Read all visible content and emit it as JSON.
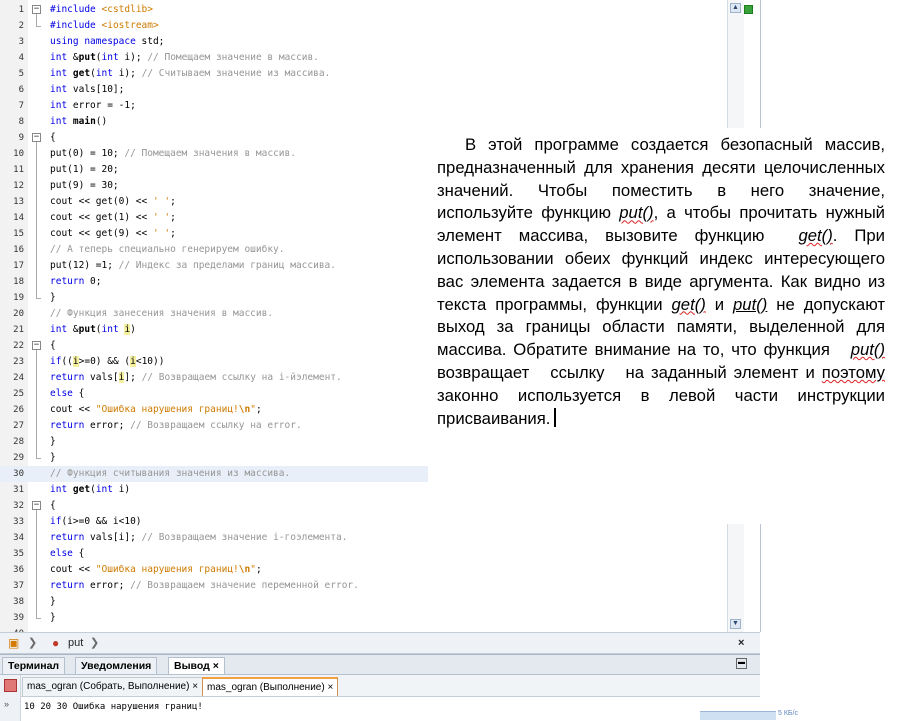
{
  "code_lines": [
    {
      "n": "1",
      "fold": "minus",
      "html": "<span class=\"kw\">#include</span> <span class=\"st\">&lt;cstdlib&gt;</span>"
    },
    {
      "n": "2",
      "fold": "end",
      "html": "<span class=\"kw\">#include</span> <span class=\"st\">&lt;iostream&gt;</span>"
    },
    {
      "n": "3",
      "html": "<span class=\"kw\">using namespace</span> std;"
    },
    {
      "n": "4",
      "html": "<span class=\"kw\">int</span> &amp;<span class=\"b\">put</span>(<span class=\"kw\">int</span> i); <span class=\"cm\">// Помещаем значение в массив.</span>"
    },
    {
      "n": "5",
      "html": "<span class=\"kw\">int</span> <span class=\"b\">get</span>(<span class=\"kw\">int</span> i); <span class=\"cm\">// Считываем значение из массива.</span>"
    },
    {
      "n": "6",
      "html": "<span class=\"kw\">int</span> vals[10];"
    },
    {
      "n": "7",
      "html": "<span class=\"kw\">int</span> error = -1;"
    },
    {
      "n": "8",
      "html": "<span class=\"kw\">int</span> <span class=\"b\">main</span>()"
    },
    {
      "n": "9",
      "fold": "minus",
      "html": "{"
    },
    {
      "n": "10",
      "html": "put(0) = 10; <span class=\"cm\">// Помещаем значения в массив.</span>"
    },
    {
      "n": "11",
      "html": "put(1) = 20;"
    },
    {
      "n": "12",
      "html": "put(9) = 30;"
    },
    {
      "n": "13",
      "html": "cout &lt;&lt; get(0) &lt;&lt; <span class=\"st\">' '</span>;"
    },
    {
      "n": "14",
      "html": "cout &lt;&lt; get(1) &lt;&lt; <span class=\"st\">' '</span>;"
    },
    {
      "n": "15",
      "html": "cout &lt;&lt; get(9) &lt;&lt; <span class=\"st\">' '</span>;"
    },
    {
      "n": "16",
      "html": "<span class=\"cm\">// А теперь специально генерируем ошибку.</span>"
    },
    {
      "n": "17",
      "html": "put(12) =1; <span class=\"cm\">// Индекс за пределами границ массива.</span>"
    },
    {
      "n": "18",
      "html": "<span class=\"kw\">return</span> 0;"
    },
    {
      "n": "19",
      "fold": "end",
      "html": "}"
    },
    {
      "n": "20",
      "html": "<span class=\"cm\">// Функция занесения значения в массив.</span>"
    },
    {
      "n": "21",
      "html": "<span class=\"kw\">int</span> &amp;<span class=\"b\">put</span>(<span class=\"kw\">int</span> <span class=\"mark\">i</span>)"
    },
    {
      "n": "22",
      "fold": "minus",
      "html": "{"
    },
    {
      "n": "23",
      "html": "<span class=\"kw\">if</span>((<span class=\"mark\">i</span>&gt;=0) &amp;&amp; (<span class=\"mark\">i</span>&lt;10))"
    },
    {
      "n": "24",
      "html": "<span class=\"kw\">return</span> vals[<span class=\"mark\">i</span>]; <span class=\"cm\">// Возвращаем ссылку на i-йэлемент.</span>"
    },
    {
      "n": "25",
      "html": "<span class=\"kw\">else</span> {"
    },
    {
      "n": "26",
      "html": "cout &lt;&lt; <span class=\"st\">\"Ошибка нарушения границ!<b>\\n</b>\"</span>;"
    },
    {
      "n": "27",
      "html": "<span class=\"kw\">return</span> error; <span class=\"cm\">// Возвращаем ссылку на error.</span>"
    },
    {
      "n": "28",
      "html": "}"
    },
    {
      "n": "29",
      "fold": "end",
      "html": "}"
    },
    {
      "n": "30",
      "hl": true,
      "html": "<span class=\"cm\">// Функция считывания значения из массива.</span>"
    },
    {
      "n": "31",
      "html": "<span class=\"kw\">int</span> <span class=\"b\">get</span>(<span class=\"kw\">int</span> i)"
    },
    {
      "n": "32",
      "fold": "minus",
      "html": "{"
    },
    {
      "n": "33",
      "html": "<span class=\"kw\">if</span>(i&gt;=0 &amp;&amp; i&lt;10)"
    },
    {
      "n": "34",
      "html": "<span class=\"kw\">return</span> vals[i]; <span class=\"cm\">// Возвращаем значение i-гоэлемента.</span>"
    },
    {
      "n": "35",
      "html": "<span class=\"kw\">else</span> {"
    },
    {
      "n": "36",
      "html": "cout &lt;&lt; <span class=\"st\">\"Ошибка нарушения границ!<b>\\n</b>\"</span>;"
    },
    {
      "n": "37",
      "html": "<span class=\"kw\">return</span> error; <span class=\"cm\">// Возвращаем значение переменной error.</span>"
    },
    {
      "n": "38",
      "html": "}"
    },
    {
      "n": "39",
      "fold": "end",
      "html": "}"
    },
    {
      "n": "40",
      "html": ""
    }
  ],
  "description_html": "В этой программе создается безопасный массив, предназначенный для хранения десяти целочисленных значений. Чтобы поместить в него значение, используйте функцию <span class=\"it wave\">put()</span>, а чтобы прочитать нужный элемент массива, вызовите функцию &nbsp;<span class=\"it wave\">get()</span>. При использовании обеих функций индекс интересующего вас элемента задается в виде аргумента. Как видно из текста программы, функции <span class=\"it wave\">get()</span> и <span class=\"it\" style=\"text-decoration:underline\">put()</span> не допускают выход за границы области памяти, выделенной для массива. Обратите внимание на то, что функция &nbsp;&nbsp;<span class=\"it wave\">put()</span> возвращает &nbsp;&nbsp;ссылку &nbsp;&nbsp;на заданный элемент и <span class=\"wave\">поэтому</span> законно используется в левой части инструкции присваивания.",
  "navbar": {
    "function_name": "put",
    "close": "×"
  },
  "tabs": [
    {
      "label": "Терминал"
    },
    {
      "label": "Уведомления"
    },
    {
      "label": "Вывод ×",
      "active": true
    }
  ],
  "subtabs": [
    {
      "label": "mas_ogran (Собрать, Выполнение) ×"
    },
    {
      "label": "mas_ogran (Выполнение) ×",
      "active": true
    }
  ],
  "output_text": "10 20 30 Ошибка нарушения границ!",
  "taskbar": {
    "net_speed": "5 КБ/с"
  },
  "colors": {
    "keyword": "#0000e6",
    "comment": "#969696",
    "string": "#ce7b00",
    "highlight_line": "#e9eff8"
  }
}
